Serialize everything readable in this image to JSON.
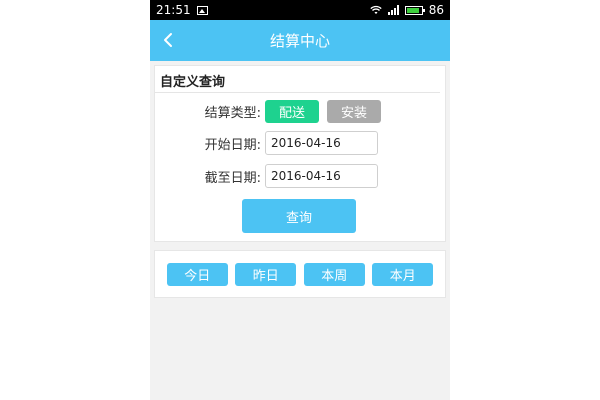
{
  "status_bar": {
    "time": "21:51",
    "battery": "86",
    "icons": [
      "image-icon",
      "wifi-icon",
      "signal-icon",
      "battery-icon"
    ]
  },
  "header": {
    "title": "结算中心",
    "back_icon": "chevron-left-icon"
  },
  "query_panel": {
    "heading": "自定义查询",
    "type_label": "结算类型:",
    "type_options": [
      {
        "label": "配送",
        "selected": true,
        "color": "#1ed28f"
      },
      {
        "label": "安装",
        "selected": false,
        "color": "#aaaaaa"
      }
    ],
    "start_label": "开始日期:",
    "start_value": "2016-04-16",
    "end_label": "截至日期:",
    "end_value": "2016-04-16",
    "query_button": "查询"
  },
  "quick_buttons": [
    "今日",
    "昨日",
    "本周",
    "本月"
  ],
  "colors": {
    "accent": "#4cc3f3",
    "selected": "#1ed28f",
    "unselected": "#aaaaaa",
    "background": "#f2f2f2"
  }
}
